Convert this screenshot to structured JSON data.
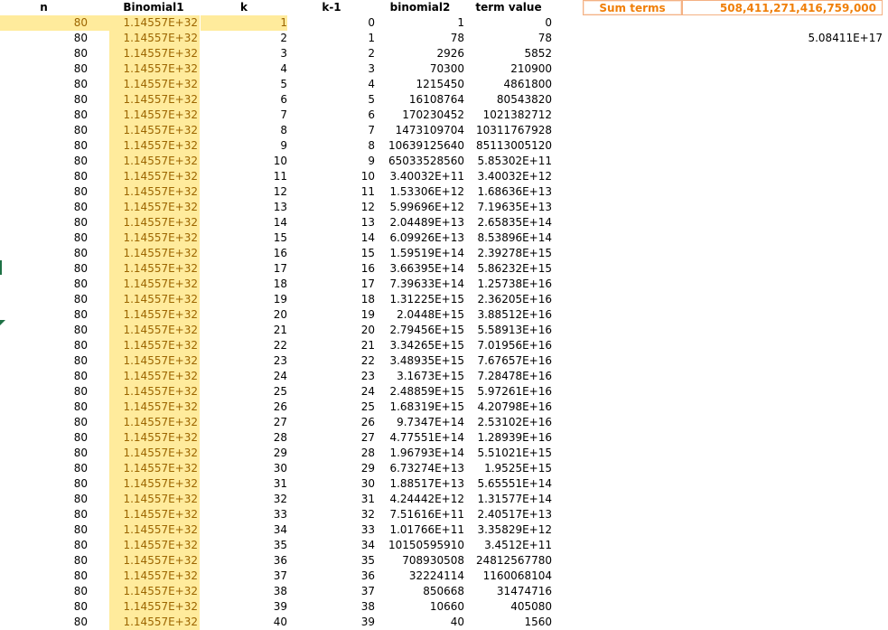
{
  "headers": {
    "n": "n",
    "binomial1": "Binomial1",
    "k": "k",
    "k_minus_1": "k-1",
    "binomial2": "binomial2",
    "term_value": "term value"
  },
  "summary": {
    "label": "Sum terms",
    "value": "508,411,271,416,759,000",
    "sci": "5.08411E+17"
  },
  "colors": {
    "highlight_fill": "#ffeb9c",
    "highlight_text": "#9c6500",
    "accent_orange": "#f07f09"
  },
  "rows": [
    {
      "n": "80",
      "b1": "1.14557E+32",
      "k": "1",
      "km1": "0",
      "b2": "1",
      "tv": "0"
    },
    {
      "n": "80",
      "b1": "1.14557E+32",
      "k": "2",
      "km1": "1",
      "b2": "78",
      "tv": "78"
    },
    {
      "n": "80",
      "b1": "1.14557E+32",
      "k": "3",
      "km1": "2",
      "b2": "2926",
      "tv": "5852"
    },
    {
      "n": "80",
      "b1": "1.14557E+32",
      "k": "4",
      "km1": "3",
      "b2": "70300",
      "tv": "210900"
    },
    {
      "n": "80",
      "b1": "1.14557E+32",
      "k": "5",
      "km1": "4",
      "b2": "1215450",
      "tv": "4861800"
    },
    {
      "n": "80",
      "b1": "1.14557E+32",
      "k": "6",
      "km1": "5",
      "b2": "16108764",
      "tv": "80543820"
    },
    {
      "n": "80",
      "b1": "1.14557E+32",
      "k": "7",
      "km1": "6",
      "b2": "170230452",
      "tv": "1021382712"
    },
    {
      "n": "80",
      "b1": "1.14557E+32",
      "k": "8",
      "km1": "7",
      "b2": "1473109704",
      "tv": "10311767928"
    },
    {
      "n": "80",
      "b1": "1.14557E+32",
      "k": "9",
      "km1": "8",
      "b2": "10639125640",
      "tv": "85113005120"
    },
    {
      "n": "80",
      "b1": "1.14557E+32",
      "k": "10",
      "km1": "9",
      "b2": "65033528560",
      "tv": "5.85302E+11"
    },
    {
      "n": "80",
      "b1": "1.14557E+32",
      "k": "11",
      "km1": "10",
      "b2": "3.40032E+11",
      "tv": "3.40032E+12"
    },
    {
      "n": "80",
      "b1": "1.14557E+32",
      "k": "12",
      "km1": "11",
      "b2": "1.53306E+12",
      "tv": "1.68636E+13"
    },
    {
      "n": "80",
      "b1": "1.14557E+32",
      "k": "13",
      "km1": "12",
      "b2": "5.99696E+12",
      "tv": "7.19635E+13"
    },
    {
      "n": "80",
      "b1": "1.14557E+32",
      "k": "14",
      "km1": "13",
      "b2": "2.04489E+13",
      "tv": "2.65835E+14"
    },
    {
      "n": "80",
      "b1": "1.14557E+32",
      "k": "15",
      "km1": "14",
      "b2": "6.09926E+13",
      "tv": "8.53896E+14"
    },
    {
      "n": "80",
      "b1": "1.14557E+32",
      "k": "16",
      "km1": "15",
      "b2": "1.59519E+14",
      "tv": "2.39278E+15"
    },
    {
      "n": "80",
      "b1": "1.14557E+32",
      "k": "17",
      "km1": "16",
      "b2": "3.66395E+14",
      "tv": "5.86232E+15"
    },
    {
      "n": "80",
      "b1": "1.14557E+32",
      "k": "18",
      "km1": "17",
      "b2": "7.39633E+14",
      "tv": "1.25738E+16"
    },
    {
      "n": "80",
      "b1": "1.14557E+32",
      "k": "19",
      "km1": "18",
      "b2": "1.31225E+15",
      "tv": "2.36205E+16"
    },
    {
      "n": "80",
      "b1": "1.14557E+32",
      "k": "20",
      "km1": "19",
      "b2": "2.0448E+15",
      "tv": "3.88512E+16"
    },
    {
      "n": "80",
      "b1": "1.14557E+32",
      "k": "21",
      "km1": "20",
      "b2": "2.79456E+15",
      "tv": "5.58913E+16"
    },
    {
      "n": "80",
      "b1": "1.14557E+32",
      "k": "22",
      "km1": "21",
      "b2": "3.34265E+15",
      "tv": "7.01956E+16"
    },
    {
      "n": "80",
      "b1": "1.14557E+32",
      "k": "23",
      "km1": "22",
      "b2": "3.48935E+15",
      "tv": "7.67657E+16"
    },
    {
      "n": "80",
      "b1": "1.14557E+32",
      "k": "24",
      "km1": "23",
      "b2": "3.1673E+15",
      "tv": "7.28478E+16"
    },
    {
      "n": "80",
      "b1": "1.14557E+32",
      "k": "25",
      "km1": "24",
      "b2": "2.48859E+15",
      "tv": "5.97261E+16"
    },
    {
      "n": "80",
      "b1": "1.14557E+32",
      "k": "26",
      "km1": "25",
      "b2": "1.68319E+15",
      "tv": "4.20798E+16"
    },
    {
      "n": "80",
      "b1": "1.14557E+32",
      "k": "27",
      "km1": "26",
      "b2": "9.7347E+14",
      "tv": "2.53102E+16"
    },
    {
      "n": "80",
      "b1": "1.14557E+32",
      "k": "28",
      "km1": "27",
      "b2": "4.77551E+14",
      "tv": "1.28939E+16"
    },
    {
      "n": "80",
      "b1": "1.14557E+32",
      "k": "29",
      "km1": "28",
      "b2": "1.96793E+14",
      "tv": "5.51021E+15"
    },
    {
      "n": "80",
      "b1": "1.14557E+32",
      "k": "30",
      "km1": "29",
      "b2": "6.73274E+13",
      "tv": "1.9525E+15"
    },
    {
      "n": "80",
      "b1": "1.14557E+32",
      "k": "31",
      "km1": "30",
      "b2": "1.88517E+13",
      "tv": "5.65551E+14"
    },
    {
      "n": "80",
      "b1": "1.14557E+32",
      "k": "32",
      "km1": "31",
      "b2": "4.24442E+12",
      "tv": "1.31577E+14"
    },
    {
      "n": "80",
      "b1": "1.14557E+32",
      "k": "33",
      "km1": "32",
      "b2": "7.51616E+11",
      "tv": "2.40517E+13"
    },
    {
      "n": "80",
      "b1": "1.14557E+32",
      "k": "34",
      "km1": "33",
      "b2": "1.01766E+11",
      "tv": "3.35829E+12"
    },
    {
      "n": "80",
      "b1": "1.14557E+32",
      "k": "35",
      "km1": "34",
      "b2": "10150595910",
      "tv": "3.4512E+11"
    },
    {
      "n": "80",
      "b1": "1.14557E+32",
      "k": "36",
      "km1": "35",
      "b2": "708930508",
      "tv": "24812567780"
    },
    {
      "n": "80",
      "b1": "1.14557E+32",
      "k": "37",
      "km1": "36",
      "b2": "32224114",
      "tv": "1160068104"
    },
    {
      "n": "80",
      "b1": "1.14557E+32",
      "k": "38",
      "km1": "37",
      "b2": "850668",
      "tv": "31474716"
    },
    {
      "n": "80",
      "b1": "1.14557E+32",
      "k": "39",
      "km1": "38",
      "b2": "10660",
      "tv": "405080"
    },
    {
      "n": "80",
      "b1": "1.14557E+32",
      "k": "40",
      "km1": "39",
      "b2": "40",
      "tv": "1560"
    }
  ]
}
